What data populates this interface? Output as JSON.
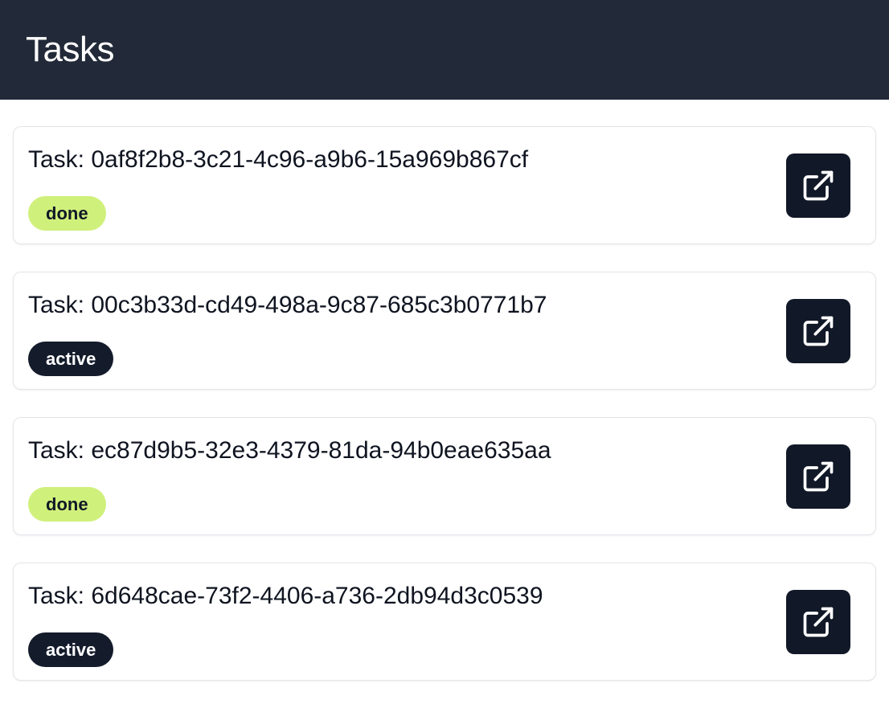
{
  "header": {
    "title": "Tasks"
  },
  "tasks": [
    {
      "title": "Task: 0af8f2b8-3c21-4c96-a9b6-15a969b867cf",
      "status": "done",
      "action_icon": "external-link-icon"
    },
    {
      "title": "Task: 00c3b33d-cd49-498a-9c87-685c3b0771b7",
      "status": "active",
      "action_icon": "external-link-icon"
    },
    {
      "title": "Task: ec87d9b5-32e3-4379-81da-94b0eae635aa",
      "status": "done",
      "action_icon": "external-link-icon"
    },
    {
      "title": "Task: 6d648cae-73f2-4406-a736-2db94d3c0539",
      "status": "active",
      "action_icon": "external-link-icon"
    }
  ],
  "colors": {
    "header_bg": "#222938",
    "done_badge": "#d0f07c",
    "active_badge": "#141b2b",
    "action_button": "#111827"
  }
}
